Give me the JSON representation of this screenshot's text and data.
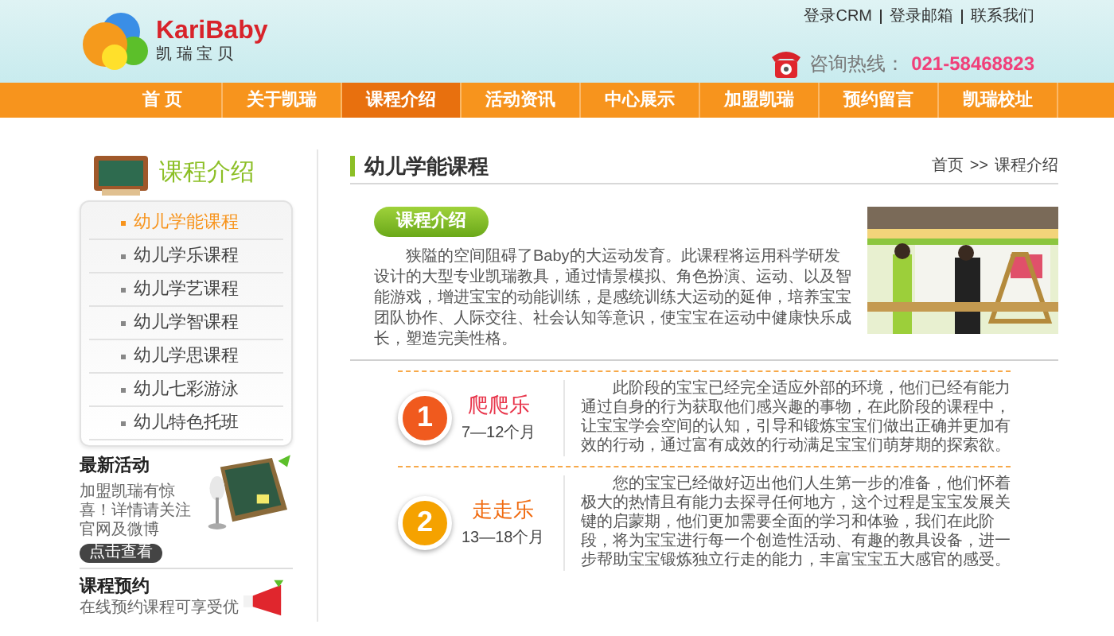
{
  "header": {
    "brand": "KariBaby",
    "brand_sub": "凯 瑞 宝 贝",
    "top_links": [
      "登录CRM",
      "登录邮箱",
      "联系我们"
    ],
    "hotline_label": "咨询热线：",
    "hotline": "021-58468823"
  },
  "nav": [
    {
      "label": "首 页",
      "selected": false
    },
    {
      "label": "关于凯瑞",
      "selected": false
    },
    {
      "label": "课程介绍",
      "selected": true
    },
    {
      "label": "活动资讯",
      "selected": false
    },
    {
      "label": "中心展示",
      "selected": false
    },
    {
      "label": "加盟凯瑞",
      "selected": false
    },
    {
      "label": "预约留言",
      "selected": false
    },
    {
      "label": "凯瑞校址",
      "selected": false
    }
  ],
  "sidebar": {
    "title": "课程介绍",
    "items": [
      {
        "label": "幼儿学能课程",
        "selected": true
      },
      {
        "label": "幼儿学乐课程",
        "selected": false
      },
      {
        "label": "幼儿学艺课程",
        "selected": false
      },
      {
        "label": "幼儿学智课程",
        "selected": false
      },
      {
        "label": "幼儿学思课程",
        "selected": false
      },
      {
        "label": "幼儿七彩游泳",
        "selected": false
      },
      {
        "label": "幼儿特色托班",
        "selected": false
      }
    ],
    "news": {
      "title": "最新活动",
      "text": "加盟凯瑞有惊喜！详情请关注官网及微博",
      "button": "点击查看"
    },
    "booking": {
      "title": "课程预约",
      "text": "在线预约课程可享受优"
    }
  },
  "main": {
    "title": "幼儿学能课程",
    "breadcrumb": [
      "首页",
      ">>",
      "课程介绍"
    ],
    "section_tag": "课程介绍",
    "intro": "狭隘的空间阻碍了Baby的大运动发育。此课程将运用科学研发设计的大型专业凯瑞教具，通过情景模拟、角色扮演、运动、以及智能游戏，增进宝宝的动能训练，是感统训练大运动的延伸，培养宝宝团队协作、人际交往、社会认知等意识，使宝宝在运动中健康快乐成长，塑造完美性格。",
    "stages": [
      {
        "badge": "1",
        "color": "#f05a1e",
        "name": "爬爬乐",
        "age": "7—12个月",
        "text": "此阶段的宝宝已经完全适应外部的环境，他们已经有能力通过自身的行为获取他们感兴趣的事物，在此阶段的课程中，让宝宝学会空间的认知，引导和锻炼宝宝们做出正确并更加有效的行动，通过富有成效的行动满足宝宝们萌芽期的探索欲。"
      },
      {
        "badge": "2",
        "color": "#f5a200",
        "name": "走走乐",
        "age": "13—18个月",
        "text": "您的宝宝已经做好迈出他们人生第一步的准备，他们怀着极大的热情且有能力去探寻任何地方，这个过程是宝宝发展关键的启蒙期，他们更加需要全面的学习和体验，我们在此阶段，将为宝宝进行每一个创造性活动、有趣的教具设备，进一步帮助宝宝锻炼独立行走的能力，丰富宝宝五大感官的感受。"
      }
    ]
  }
}
